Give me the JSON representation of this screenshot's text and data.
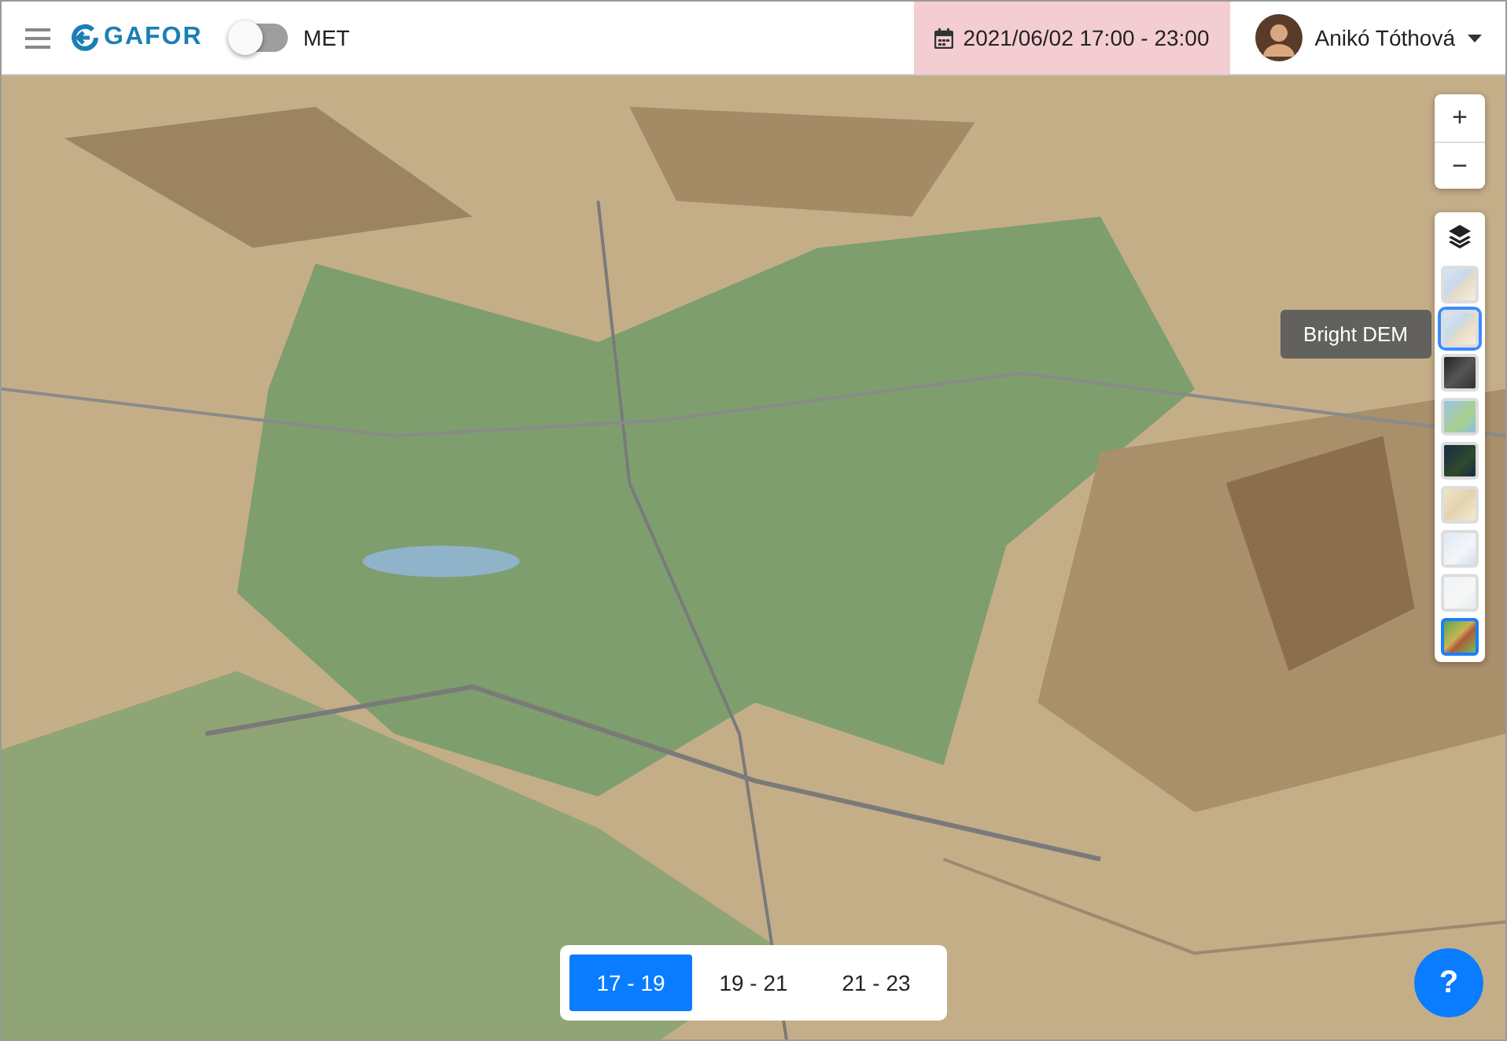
{
  "header": {
    "logo": "GAFOR",
    "met_toggle": {
      "label": "MET",
      "on": false
    },
    "date_range": "2021/06/02 17:00 - 23:00",
    "user": {
      "name": "Anikó Tóthová"
    }
  },
  "zoom_controls": [
    "+",
    "−"
  ],
  "layers": [
    {
      "kind": "bright",
      "selected": false,
      "hovered": false
    },
    {
      "kind": "bright",
      "selected": false,
      "hovered": true,
      "tooltip": "Bright DEM"
    },
    {
      "kind": "dark",
      "selected": false,
      "hovered": false
    },
    {
      "kind": "blue",
      "selected": false,
      "hovered": false
    },
    {
      "kind": "night",
      "selected": false,
      "hovered": false
    },
    {
      "kind": "paper",
      "selected": false,
      "hovered": false
    },
    {
      "kind": "outline",
      "selected": false,
      "hovered": false
    },
    {
      "kind": "pale",
      "selected": false,
      "hovered": false
    },
    {
      "kind": "relief",
      "selected": true,
      "hovered": false
    }
  ],
  "time_slots": [
    {
      "label": "17 - 19",
      "selected": true
    },
    {
      "label": "19 - 21",
      "selected": false
    },
    {
      "label": "21 - 23",
      "selected": false
    }
  ],
  "help_button": "?"
}
